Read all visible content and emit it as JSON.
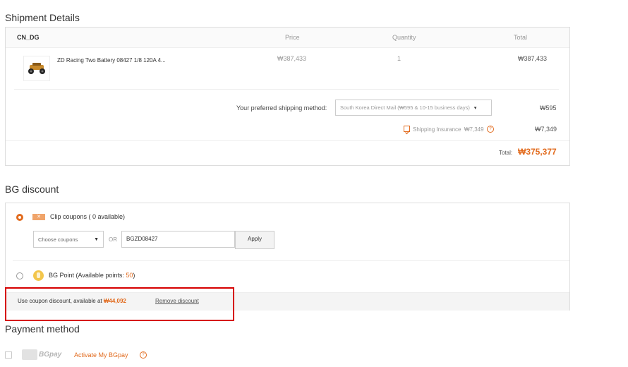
{
  "shipment": {
    "title": "Shipment Details",
    "warehouse": "CN_DG",
    "columns": {
      "price": "Price",
      "quantity": "Quantity",
      "total": "Total"
    },
    "product": {
      "name": "ZD Racing Two Battery 08427 1/8 120A 4...",
      "price": "₩387,433",
      "quantity": "1",
      "total": "₩387,433"
    },
    "shipping": {
      "label": "Your preferred shipping method:",
      "selected": "South Korea Direct Mail (₩595 & 10-15 business days)",
      "cost": "₩595"
    },
    "insurance": {
      "label": "Shipping Insurance",
      "amount": "₩7,349",
      "total": "₩7,349",
      "checked": true
    },
    "total": {
      "label": "Total:",
      "value": "₩375,377"
    }
  },
  "bg_discount": {
    "title": "BG discount",
    "clip_coupons": {
      "label": "Clip coupons ( 0 available)",
      "select_placeholder": "Choose coupons",
      "or": "OR",
      "code": "BGZD08427",
      "apply": "Apply"
    },
    "bg_point": {
      "label": "BG Point (Available points: ",
      "points": "50",
      "suffix": ")"
    },
    "coupon_notice": {
      "text": "Use coupon discount, available at ",
      "amount": "₩44,092",
      "remove": "Remove discount"
    }
  },
  "payment": {
    "title": "Payment method",
    "bgpay": {
      "brand": "BGpay",
      "activate": "Activate My BGpay"
    }
  },
  "colors": {
    "accent": "#e26b1e",
    "highlight_border": "#d60000"
  }
}
